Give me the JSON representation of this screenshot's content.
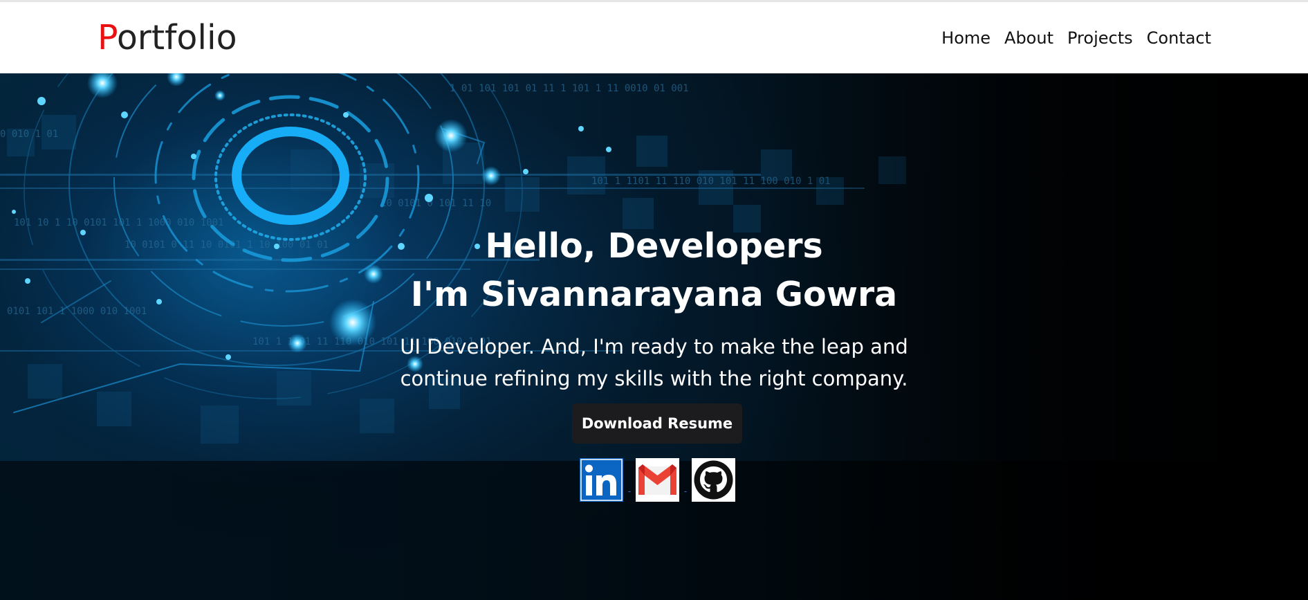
{
  "brand": {
    "first_letter": "P",
    "rest": "ortfolio"
  },
  "nav": {
    "items": [
      "Home",
      "About",
      "Projects",
      "Contact"
    ]
  },
  "hero": {
    "greeting": "Hello, Developers",
    "name": "I'm Sivannarayana Gowra",
    "description_line1": "UI Developer. And, I'm ready to make the leap and",
    "description_line2": "continue refining my skills with the right company.",
    "button_label": "Download Resume",
    "socials": [
      {
        "icon": "linkedin-icon"
      },
      {
        "icon": "gmail-icon"
      },
      {
        "icon": "github-icon"
      }
    ],
    "separator": "-"
  },
  "colors": {
    "brand_accent": "#e81010",
    "button_bg": "#1c1c1e",
    "glow": "#19b7ff",
    "linkedin": "#0a66c2",
    "gmail_red": "#ea4335"
  }
}
